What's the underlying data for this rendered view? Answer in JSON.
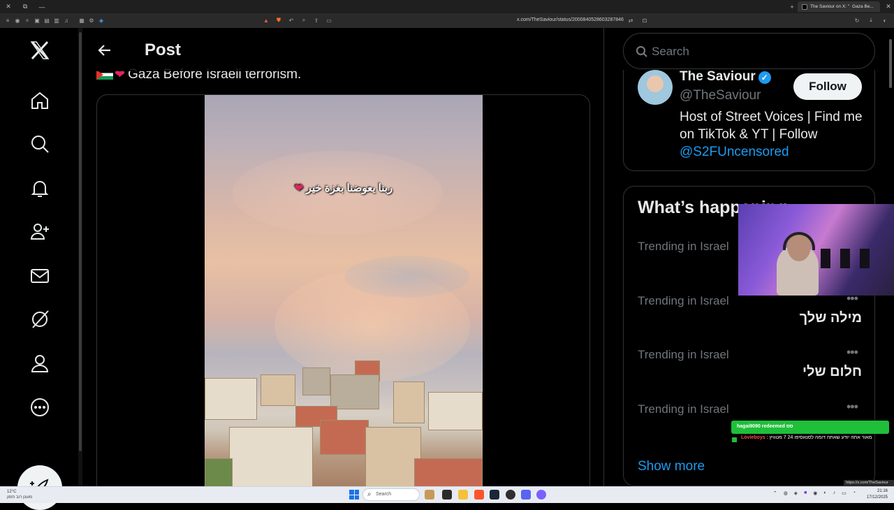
{
  "browser": {
    "tab_title": "The Saviour on X: \"",
    "tab_title_suffix": "Gaza Be...",
    "url": "x.com/TheSaviour/status/2000840528603287846",
    "status_url": "https://x.com/TheSaviour"
  },
  "header": {
    "title": "Post"
  },
  "tweet": {
    "text": "Gaza Before Israeli terrorism.",
    "video_caption": "ربنا يعوضنا بغزة خير"
  },
  "sidebar_nav": [
    "x-logo",
    "home-icon",
    "explore-icon",
    "notifications-icon",
    "communities-icon",
    "messages-icon",
    "grok-icon",
    "profile-icon",
    "more-icon"
  ],
  "search": {
    "placeholder": "Search"
  },
  "profile": {
    "name": "The Saviour",
    "handle": "@TheSaviour",
    "follow_label": "Follow",
    "bio": "Host of Street Voices | Find me on TikTok & YT | Follow ",
    "bio_link": "@S2FUncensored"
  },
  "trends": {
    "title": "What’s happening",
    "items": [
      {
        "label": "Trending in Israel",
        "name": ""
      },
      {
        "label": "Trending in Israel",
        "name": "מילה שלך"
      },
      {
        "label": "Trending in Israel",
        "name": "חלום שלי"
      },
      {
        "label": "Trending in Israel",
        "name": ""
      }
    ],
    "show_more": "Show more"
  },
  "overlay": {
    "redeem_text": "hagai9090 redeemed סס",
    "chat_user": "Lovieboys",
    "chat_message": ": מאור אתה יודע שאתה דומה לסנאסיפו 24 7 מטוויץ"
  },
  "taskbar": {
    "weather_temp": "12°C",
    "weather_desc": "מעונן רוב הזמן",
    "search_label": "Search",
    "time": "21:16",
    "date": "17/12/2025"
  },
  "colors": {
    "accent": "#1d9bf0",
    "background": "#000000",
    "border": "#2f3336",
    "muted_text": "#71767b",
    "chat_green": "#1fbf3a"
  }
}
